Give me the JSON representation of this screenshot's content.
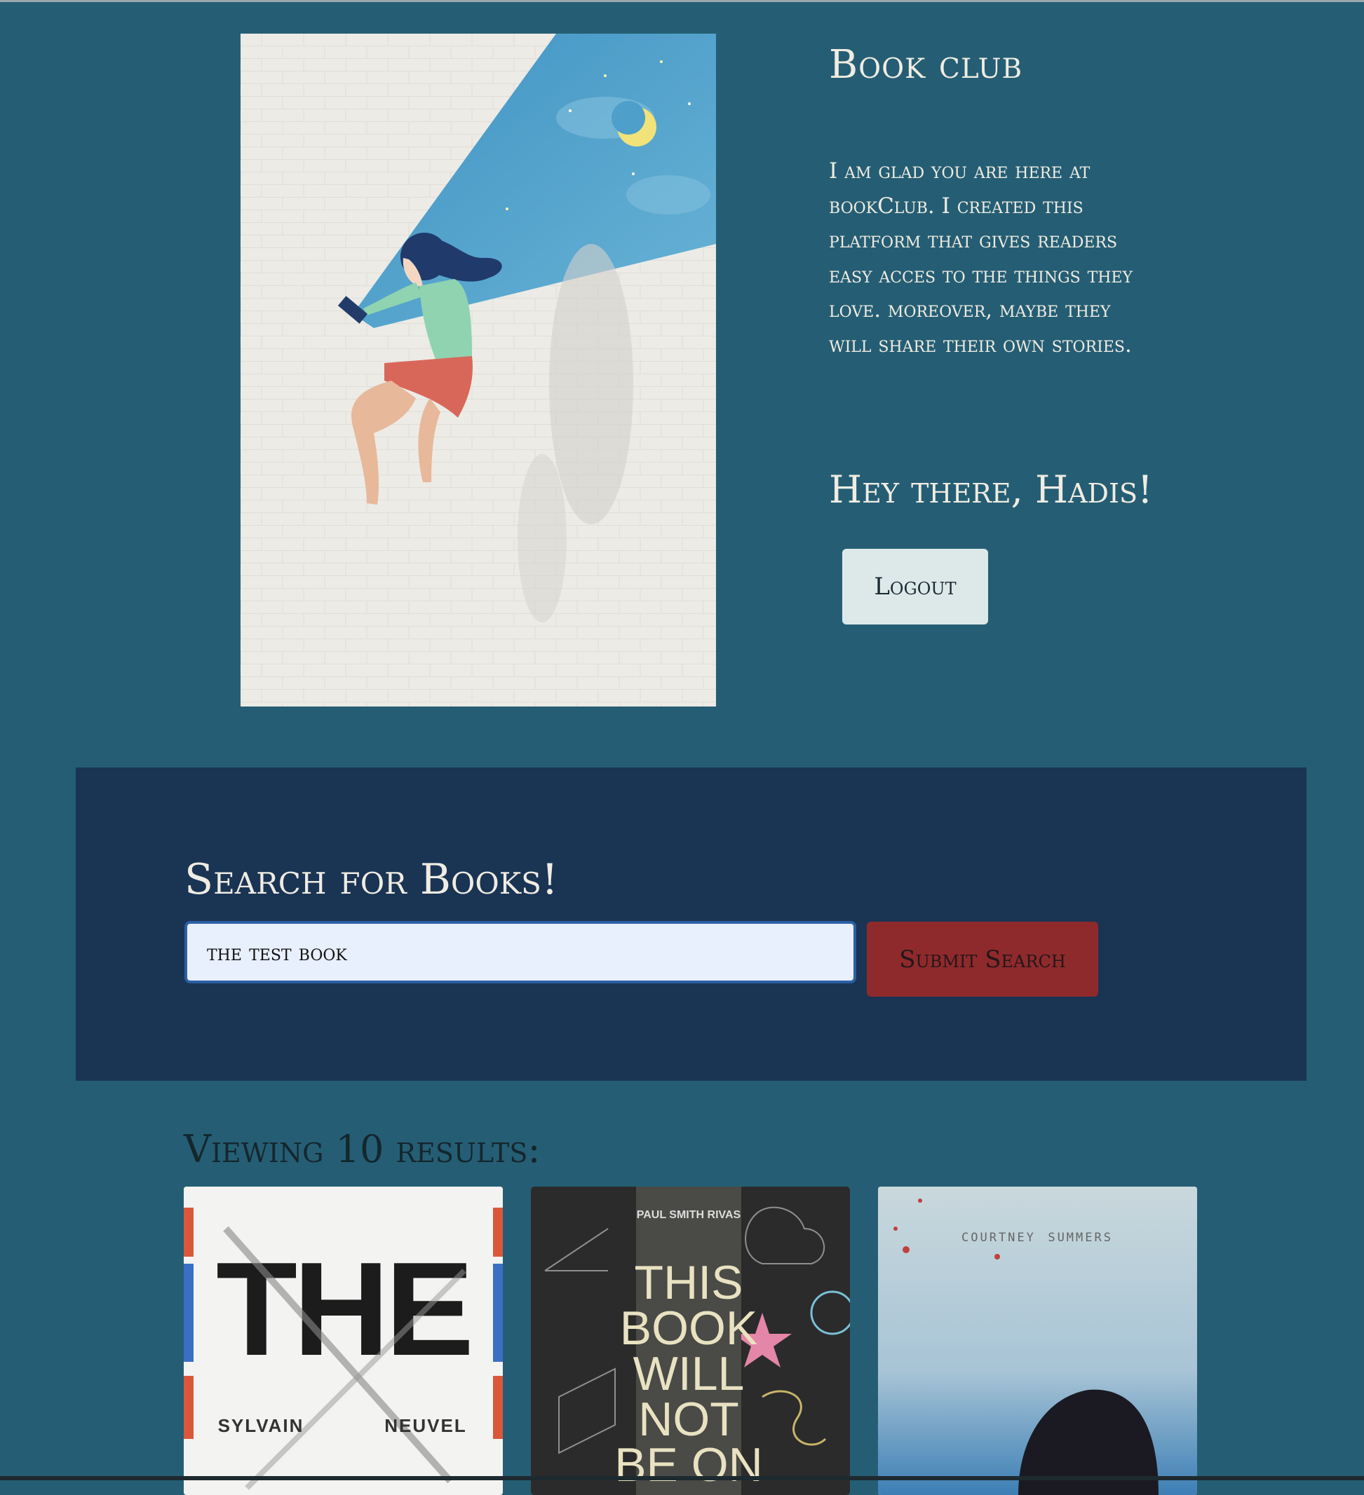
{
  "header": {
    "title": "Book club",
    "intro": "I am glad you are here at bookClub. I created this platform that gives readers easy acces to the things they love. moreover, maybe they will share their own stories.",
    "greeting": "Hey there, Hadis!",
    "logout_label": "Logout"
  },
  "search": {
    "heading": "Search for Books!",
    "input_value": "the test book",
    "submit_label": "Submit Search"
  },
  "results": {
    "heading": "Viewing 10 results:",
    "books": [
      {
        "cover_author_first": "SYLVAIN",
        "cover_author_last": "NEUVEL",
        "cover_title": "THE"
      },
      {
        "cover_author": "PAUL SMITH RIVAS",
        "cover_title_lines": [
          "THIS",
          "BOOK",
          "WILL",
          "NOT",
          "BE ON"
        ]
      },
      {
        "cover_author": "courtney summers"
      }
    ]
  },
  "colors": {
    "page_bg": "#255e74",
    "panel_bg": "#1a3454",
    "submit_bg": "#8f2a2c",
    "logout_bg": "#dde9e9"
  }
}
